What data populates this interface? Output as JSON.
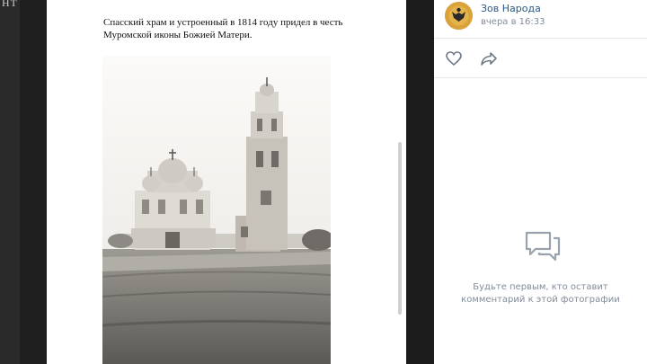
{
  "edge": {
    "glyph": "нт"
  },
  "document": {
    "caption": "Спасский храм и устроенный в 1814 году придел в честь Муромской иконы Божией Матери.",
    "photo": "old photograph of church and bell tower"
  },
  "post": {
    "author": "Зов Народа",
    "time": "вчера в 16:33",
    "avatar_icon": "double-headed-eagle-emblem"
  },
  "actions": {
    "like_icon": "heart-icon",
    "share_icon": "share-arrow-icon"
  },
  "comments": {
    "empty_icon": "comments-bubble-icon",
    "empty_line1": "Будьте первым, кто оставит",
    "empty_line2": "комментарий к этой фотографии"
  },
  "colors": {
    "link": "#2a5885",
    "muted": "#818c99",
    "avatar": "#d9a23a"
  }
}
